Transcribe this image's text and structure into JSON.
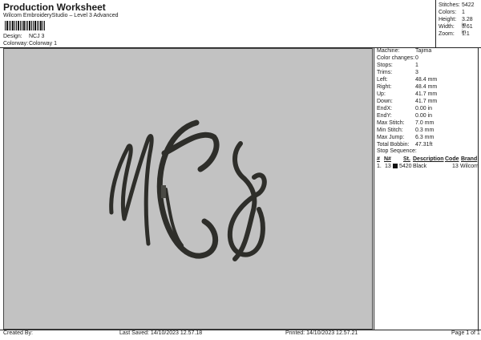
{
  "header": {
    "title": "Production Worksheet",
    "subtitle": "Wilcom EmbroideryStudio – Level 3 Advanced",
    "design_label": "Design:",
    "design_value": "NCJ 3",
    "colorway_label": "Colorway:",
    "colorway_value": "Colorway 1"
  },
  "stats": [
    {
      "label": "Stitches:",
      "value": "5422"
    },
    {
      "label": "Colors:",
      "value": "1"
    },
    {
      "label": "Height:",
      "value": "3.28 in"
    },
    {
      "label": "Width:",
      "value": "3.61 in"
    },
    {
      "label": "Zoom:",
      "value": "1:1"
    }
  ],
  "specs": [
    {
      "label": "Machine:",
      "value": "Tajima"
    },
    {
      "label": "Color changes:",
      "value": "0"
    },
    {
      "label": "Stops:",
      "value": "1"
    },
    {
      "label": "Trims:",
      "value": "3"
    },
    {
      "label": "Left:",
      "value": "48.4 mm"
    },
    {
      "label": "Right:",
      "value": "48.4 mm"
    },
    {
      "label": "Up:",
      "value": "41.7 mm"
    },
    {
      "label": "Down:",
      "value": "41.7 mm"
    },
    {
      "label": "EndX:",
      "value": "0.00 in"
    },
    {
      "label": "EndY:",
      "value": "0.00 in"
    },
    {
      "label": "Max Stitch:",
      "value": "7.0 mm"
    },
    {
      "label": "Min Stitch:",
      "value": "0.3 mm"
    },
    {
      "label": "Max Jump:",
      "value": "6.3 mm"
    },
    {
      "label": "Total Bobbin:",
      "value": "47.31ft"
    }
  ],
  "stop_sequence": {
    "title": "Stop Sequence:",
    "headers": [
      "#",
      "N#",
      "St.",
      "Description",
      "Code",
      "Brand"
    ],
    "rows": [
      {
        "num": "1.",
        "n": "13",
        "st": "5420",
        "description": "Black",
        "code": "13",
        "brand": "Wilcom",
        "color": "#111111"
      }
    ]
  },
  "footer": {
    "created": "Created By:",
    "last_saved": "Last Saved: 14/10/2023 12.57.18",
    "printed": "Printed: 14/10/2023 12.57.21",
    "page": "Page 1 of 1"
  },
  "design_thread_color": "#2e2e2a"
}
